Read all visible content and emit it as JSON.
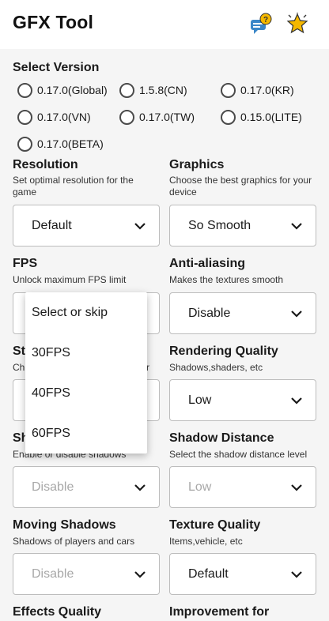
{
  "header": {
    "title": "GFX Tool",
    "help_icon": "help-chat-icon",
    "rate_icon": "star-icon"
  },
  "version": {
    "title": "Select Version",
    "options": [
      "0.17.0(Global)",
      "1.5.8(CN)",
      "0.17.0(KR)",
      "0.17.0(VN)",
      "0.17.0(TW)",
      "0.15.0(LITE)",
      "0.17.0(BETA)"
    ]
  },
  "resolution": {
    "title": "Resolution",
    "desc": "Set optimal resolution for the game",
    "value": "Default"
  },
  "graphics": {
    "title": "Graphics",
    "desc": "Choose the best graphics for your device",
    "value": "So Smooth"
  },
  "fps": {
    "title": "FPS",
    "desc": "Unlock maximum FPS limit",
    "value": ""
  },
  "antialiasing": {
    "title": "Anti-aliasing",
    "desc": "Makes the textures smooth",
    "value": "Disable"
  },
  "style": {
    "title": "St",
    "desc": "Ch",
    "desc_end": "r"
  },
  "rendering": {
    "title": "Rendering Quality",
    "desc": "Shadows,shaders, etc",
    "value": "Low"
  },
  "shadows": {
    "title": "Sh",
    "desc": "Enable or disable shadows",
    "value": "Disable"
  },
  "shadow_distance": {
    "title": "Shadow Distance",
    "desc": "Select the shadow distance level",
    "value": "Low"
  },
  "moving_shadows": {
    "title": "Moving Shadows",
    "desc": "Shadows of players and cars",
    "value": "Disable"
  },
  "texture": {
    "title": "Texture Quality",
    "desc": "Items,vehicle, etc",
    "value": "Default"
  },
  "effects": {
    "title": "Effects Quality"
  },
  "improvement": {
    "title": "Improvement for"
  },
  "fps_dropdown": {
    "options": [
      "Select or skip",
      "30FPS",
      "40FPS",
      "60FPS"
    ]
  },
  "colors": {
    "accent_star": "#f5b800",
    "help_blue": "#3a86c8",
    "disabled_text": "#a8a8a8"
  }
}
